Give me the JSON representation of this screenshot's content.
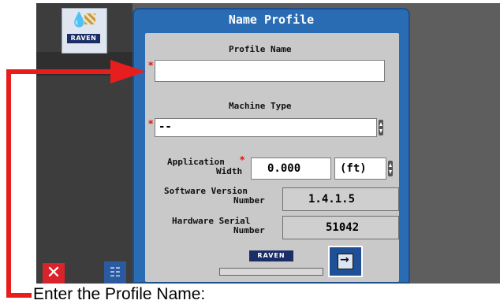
{
  "left_panel": {
    "logo_brand": "RAVEN",
    "close_icon": "close-icon",
    "route_icon": "route-icon"
  },
  "dialog": {
    "title": "Name Profile",
    "profile_name": {
      "label": "Profile Name",
      "value": "",
      "required_mark": "*"
    },
    "machine_type": {
      "label": "Machine Type",
      "value": "--",
      "required_mark": "*"
    },
    "application_width": {
      "label_line1": "Application",
      "label_line2": "Width",
      "required_mark": "*",
      "value": "0.000",
      "unit": "(ft)"
    },
    "software_version": {
      "label_line1": "Software Version",
      "label_line2": "Number",
      "value": "1.4.1.5"
    },
    "hardware_serial": {
      "label_line1": "Hardware Serial",
      "label_line2": "Number",
      "value": "51042"
    },
    "footer_brand": "RAVEN",
    "next_icon": "next-page-icon"
  },
  "annotation": {
    "caption": "Enter the Profile Name:",
    "arrow_color": "#e61e1e"
  },
  "colors": {
    "dialog_header": "#2a6cb4",
    "dialog_body": "#c9c9c9",
    "screen_bg": "#5e5e5e",
    "required": "#e01010"
  }
}
